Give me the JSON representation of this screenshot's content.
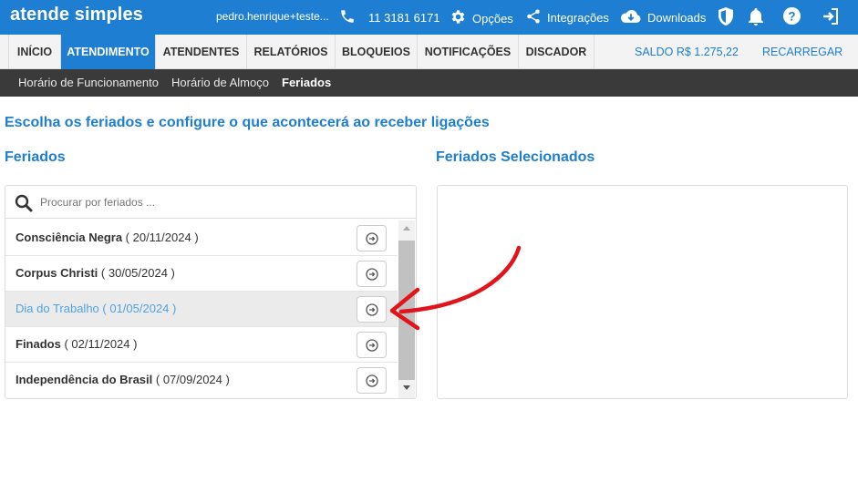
{
  "topbar": {
    "brand": "atende simples",
    "user": "pedro.henrique+teste...",
    "phone": "11 3181 6171",
    "options_label": "Opções",
    "integrations_label": "Integrações",
    "downloads_label": "Downloads"
  },
  "nav": {
    "tabs": [
      {
        "label": "INÍCIO"
      },
      {
        "label": "ATENDIMENTO"
      },
      {
        "label": "ATENDENTES"
      },
      {
        "label": "RELATÓRIOS"
      },
      {
        "label": "BLOQUEIOS"
      },
      {
        "label": "NOTIFICAÇÕES"
      },
      {
        "label": "DISCADOR"
      }
    ],
    "balance": "SALDO R$ 1.275,22",
    "recharge": "RECARREGAR"
  },
  "subnav": {
    "items": [
      {
        "label": "Horário de Funcionamento"
      },
      {
        "label": "Horário de Almoço"
      },
      {
        "label": "Feriados"
      }
    ]
  },
  "main": {
    "headline": "Escolha os feriados e configure o que acontecerá ao receber ligações",
    "left_title": "Feriados",
    "right_title": "Feriados Selecionados",
    "search_placeholder": "Procurar por feriados ...",
    "holidays": [
      {
        "name": "Consciência Negra",
        "date": "( 20/11/2024 )"
      },
      {
        "name": "Corpus Christi",
        "date": "( 30/05/2024 )"
      },
      {
        "name": "Dia do Trabalho",
        "date": "( 01/05/2024 )"
      },
      {
        "name": "Finados",
        "date": "( 02/11/2024 )"
      },
      {
        "name": "Independência do Brasil",
        "date": "( 07/09/2024 )"
      }
    ]
  },
  "colors": {
    "accent": "#1e7ed2",
    "subnav_bg": "#3a3a3a",
    "annotation_arrow": "#e0141a"
  }
}
